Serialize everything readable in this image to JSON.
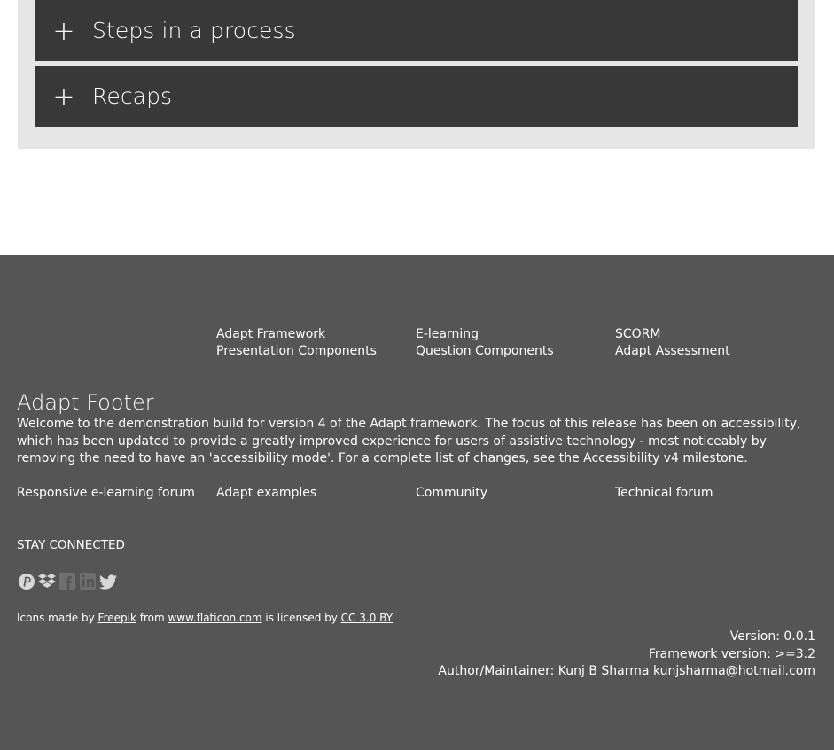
{
  "accordion": {
    "items": [
      {
        "icon": "plus-icon",
        "symbol": "+",
        "title": "Steps in a process"
      },
      {
        "icon": "plus-icon",
        "symbol": "+",
        "title": "Recaps"
      }
    ]
  },
  "footer": {
    "nav": [
      [
        "Adapt Framework",
        "Presentation Components"
      ],
      [
        "E-learning",
        "Question Components"
      ],
      [
        "SCORM",
        "Adapt Assessment"
      ]
    ],
    "title": "Adapt Footer",
    "body": "Welcome to the demonstration build for version 4 of the Adapt framework. The focus of this release has been on accessibility, which has been updated to provide a greatly improved experience for users of assistive technology - most noticeably by removing the need to have an 'accessibility mode'. For a complete list of changes, see the Accessibility v4 milestone.",
    "links": [
      "Responsive e-learning forum",
      "Adapt examples",
      "Community",
      "Technical forum"
    ],
    "stay_connected": "STAY CONNECTED",
    "social": [
      {
        "icon": "pinterest-icon"
      },
      {
        "icon": "dropbox-icon"
      },
      {
        "icon": "facebook-icon"
      },
      {
        "icon": "linkedin-icon"
      },
      {
        "icon": "twitter-icon"
      }
    ],
    "attribution": {
      "prefix": "Icons made by ",
      "author": "Freepik",
      "from": " from ",
      "site": "www.flaticon.com",
      "licensed": " is licensed by ",
      "license": "CC 3.0 BY"
    },
    "version": "Version: 0.0.1",
    "framework_version": "Framework version: >=3.2",
    "author": "Author/Maintainer: Kunj B Sharma kunjsharma@hotmail.com"
  },
  "colors": {
    "accordion_bg": "#383838",
    "accordion_wrap": "#e6e6e6",
    "footer_bg": "#555555",
    "social_icon": "#d8d8d8",
    "social_icon_dim": "#6f6f6f"
  }
}
